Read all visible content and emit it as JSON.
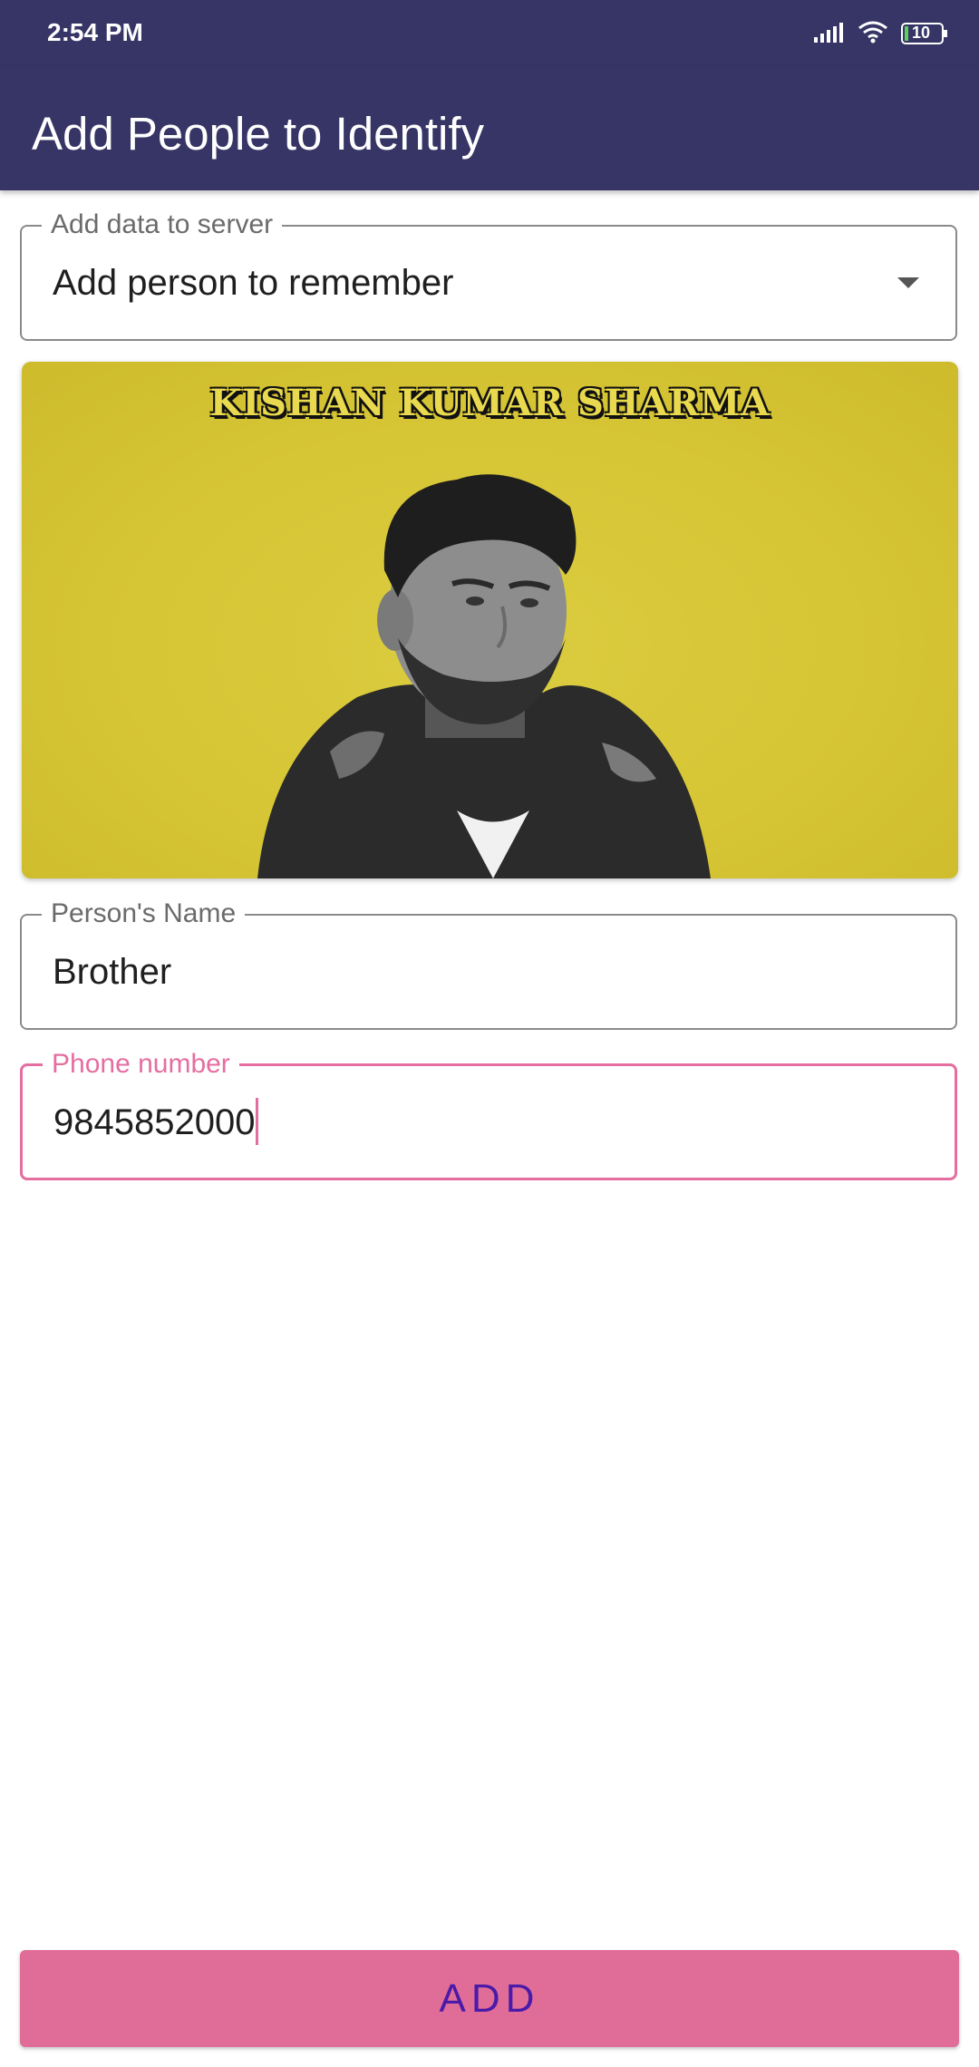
{
  "status_bar": {
    "time": "2:54 PM",
    "battery_level": "10",
    "icons": [
      "signal-icon",
      "wifi-icon",
      "battery-icon"
    ]
  },
  "app_bar": {
    "title": "Add People to Identify"
  },
  "form": {
    "action_select": {
      "label": "Add data to server",
      "value": "Add person to remember"
    },
    "photo": {
      "caption": "KISHAN KUMAR SHARMA"
    },
    "name_field": {
      "label": "Person's Name",
      "value": "Brother"
    },
    "phone_field": {
      "label": "Phone number",
      "value": "9845852000"
    },
    "submit_label": "ADD"
  },
  "colors": {
    "app_bar": "#363566",
    "accent": "#e56ea0",
    "button_bg": "#e06d98",
    "button_text": "#4a1aa8",
    "photo_bg": "#d6c534"
  }
}
